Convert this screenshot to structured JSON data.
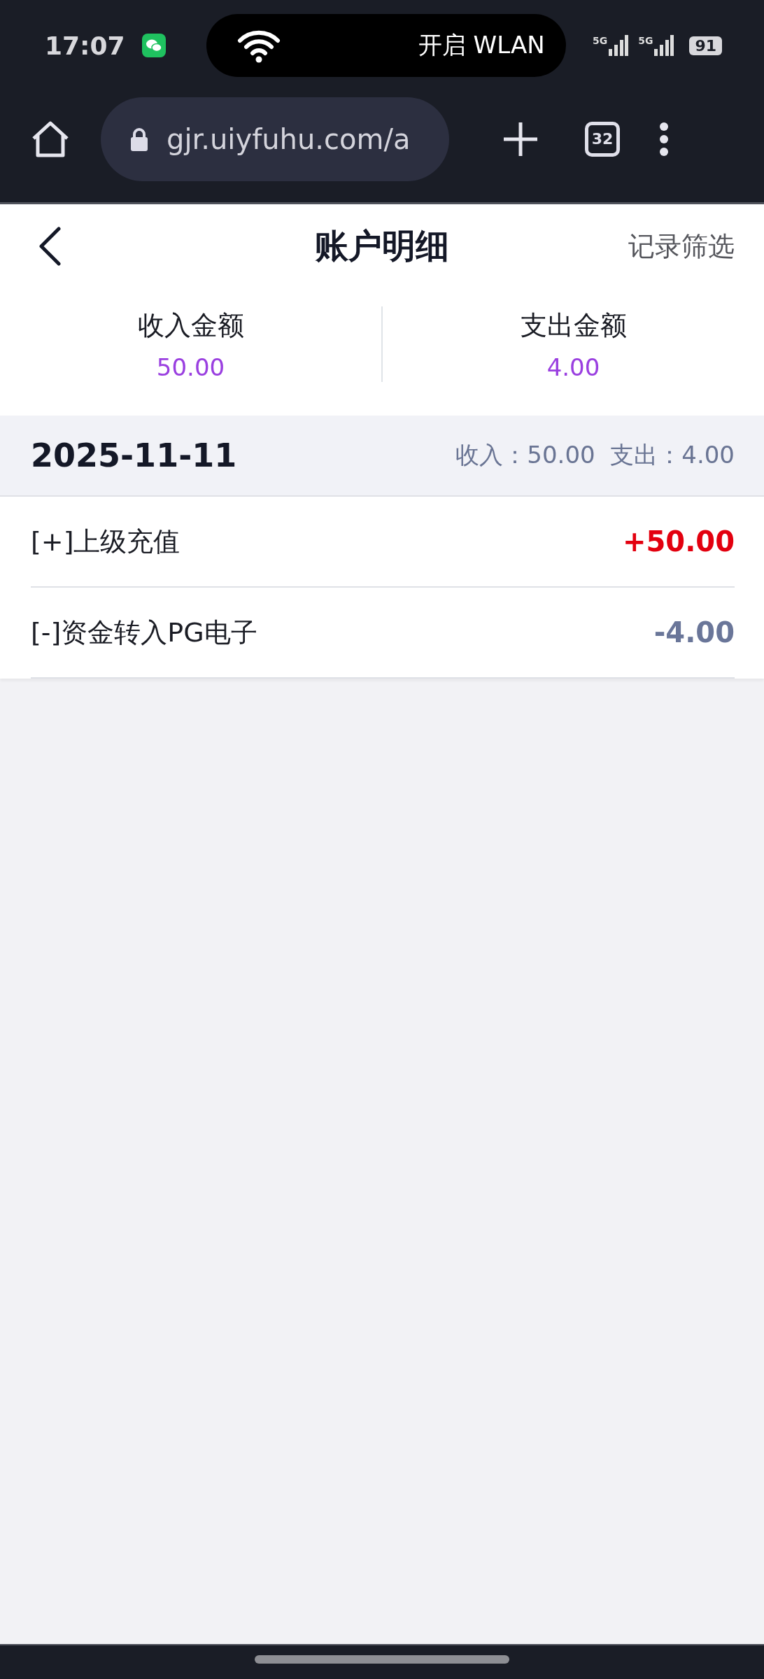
{
  "status_bar": {
    "time": "17:07",
    "notice": "开启 WLAN",
    "signal_labels": [
      "5G",
      "5G"
    ],
    "battery": "91"
  },
  "browser_bar": {
    "url": "gjr.uiyfuhu.com/a",
    "tab_count": "32"
  },
  "header": {
    "title": "账户明细",
    "action": "记录筛选"
  },
  "summary": [
    {
      "label": "收入金额",
      "value": "50.00"
    },
    {
      "label": "支出金额",
      "value": "4.00"
    }
  ],
  "groups": [
    {
      "date": "2025-11-11",
      "totals": "收入：50.00  支出：4.00",
      "transactions": [
        {
          "title": "[+]上级充值",
          "amount": "+50.00",
          "kind": "income"
        },
        {
          "title": "[-]资金转入PG电子",
          "amount": "-4.00",
          "kind": "expense"
        }
      ]
    }
  ]
}
